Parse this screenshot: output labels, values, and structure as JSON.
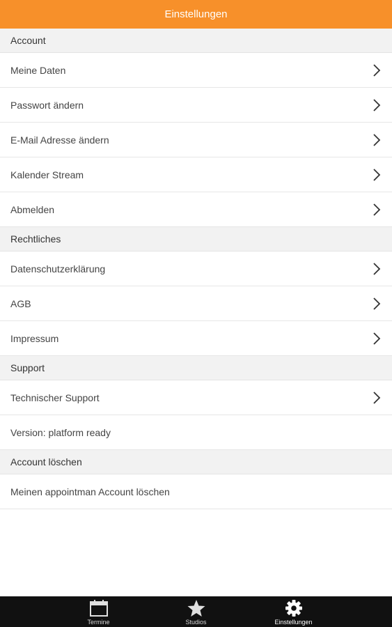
{
  "header": {
    "title": "Einstellungen"
  },
  "sections": {
    "account": {
      "title": "Account",
      "items": [
        "Meine Daten",
        "Passwort ändern",
        "E-Mail Adresse ändern",
        "Kalender Stream",
        "Abmelden"
      ]
    },
    "legal": {
      "title": "Rechtliches",
      "items": [
        "Datenschutzerklärung",
        "AGB",
        "Impressum"
      ]
    },
    "support": {
      "title": "Support",
      "items": [
        "Technischer Support"
      ],
      "version": "Version: platform ready"
    },
    "delete": {
      "title": "Account löschen",
      "items": [
        "Meinen appointman Account löschen"
      ]
    }
  },
  "tabbar": {
    "tabs": [
      {
        "label": "Termine",
        "icon": "calendar-icon"
      },
      {
        "label": "Studios",
        "icon": "star-icon"
      },
      {
        "label": "Einstellungen",
        "icon": "gear-icon",
        "active": true
      }
    ]
  },
  "colors": {
    "accent": "#f7902a",
    "tabbar": "#111111",
    "section_bg": "#f2f2f2"
  }
}
